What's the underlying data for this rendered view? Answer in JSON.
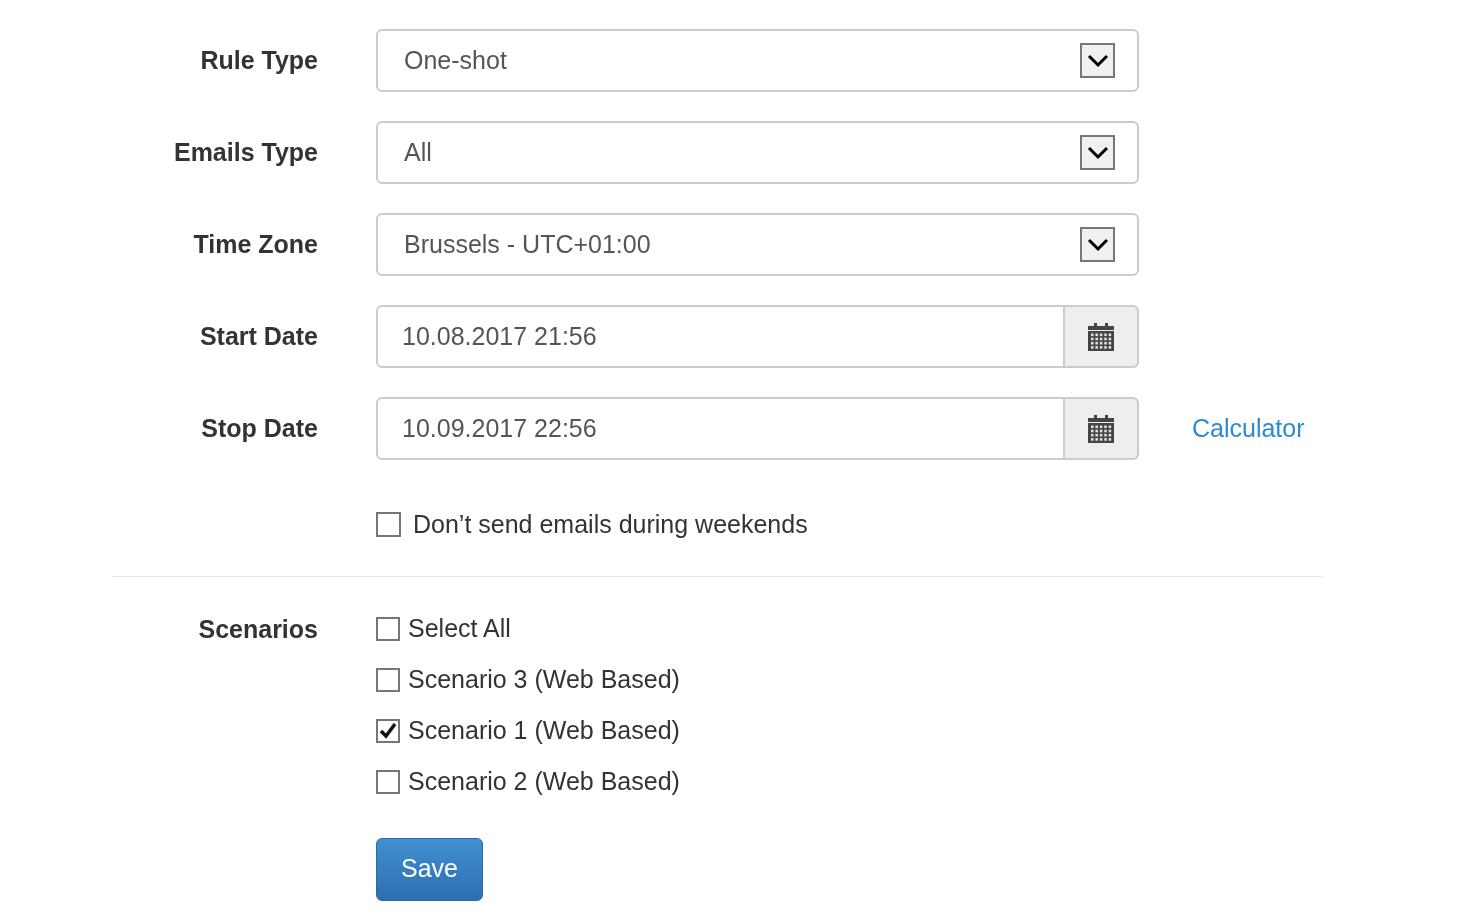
{
  "fields": [
    {
      "label": "Rule Type",
      "kind": "select",
      "value": "One-shot"
    },
    {
      "label": "Emails Type",
      "kind": "select",
      "value": "All"
    },
    {
      "label": "Time Zone",
      "kind": "select",
      "value": "Brussels - UTC+01:00"
    },
    {
      "label": "Start Date",
      "kind": "date",
      "value": "10.08.2017 21:56"
    },
    {
      "label": "Stop Date",
      "kind": "date",
      "value": "10.09.2017 22:56",
      "link": "Calculator"
    }
  ],
  "weekends": {
    "label": "Don’t send emails during weekends",
    "checked": false
  },
  "scenarios": {
    "label": "Scenarios",
    "items": [
      {
        "label": "Select All",
        "checked": false
      },
      {
        "label": "Scenario 3 (Web Based)",
        "checked": false
      },
      {
        "label": "Scenario 1 (Web Based)",
        "checked": true
      },
      {
        "label": "Scenario 2 (Web Based)",
        "checked": false
      }
    ]
  },
  "save": "Save"
}
